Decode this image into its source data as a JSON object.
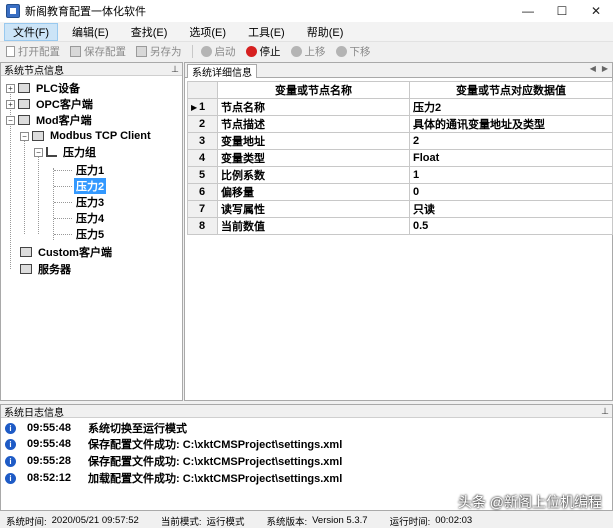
{
  "window": {
    "title": "新阁教育配置一体化软件",
    "minimize": "—",
    "maximize": "☐",
    "close": "✕"
  },
  "menu": [
    {
      "label": "文件(F)",
      "active": true
    },
    {
      "label": "编辑(E)"
    },
    {
      "label": "查找(E)"
    },
    {
      "label": "选项(E)"
    },
    {
      "label": "工具(E)"
    },
    {
      "label": "帮助(E)"
    }
  ],
  "toolbar": {
    "open": "打开配置",
    "save": "保存配置",
    "save_as": "另存为",
    "start": "启动",
    "stop": "停止",
    "up": "上移",
    "down": "下移"
  },
  "tree_panel": {
    "title": "系统节点信息",
    "pin": "⊥",
    "nodes": {
      "plc": "PLC设备",
      "opc": "OPC客户端",
      "mod": "Mod客户端",
      "modbus_tcp": "Modbus TCP Client",
      "group": "压力组",
      "p1": "压力1",
      "p2": "压力2",
      "p3": "压力3",
      "p4": "压力4",
      "p5": "压力5",
      "custom": "Custom客户端",
      "server": "服务器"
    }
  },
  "detail_panel": {
    "tab": "系统详细信息",
    "tab_prev": "◀",
    "tab_next": "▶",
    "columns": [
      "变量或节点名称",
      "变量或节点对应数据值"
    ],
    "current_row_marker": "▶",
    "rows": [
      {
        "no": "1",
        "name": "节点名称",
        "value": "压力2"
      },
      {
        "no": "2",
        "name": "节点描述",
        "value": "具体的通讯变量地址及类型"
      },
      {
        "no": "3",
        "name": "变量地址",
        "value": "2"
      },
      {
        "no": "4",
        "name": "变量类型",
        "value": "Float"
      },
      {
        "no": "5",
        "name": "比例系数",
        "value": "1"
      },
      {
        "no": "6",
        "name": "偏移量",
        "value": "0"
      },
      {
        "no": "7",
        "name": "读写属性",
        "value": "只读"
      },
      {
        "no": "8",
        "name": "当前数值",
        "value": "0.5"
      }
    ]
  },
  "log_panel": {
    "title": "系统日志信息",
    "pin": "⊥",
    "info_glyph": "i",
    "entries": [
      {
        "time": "09:55:48",
        "message": "系统切换至运行模式"
      },
      {
        "time": "09:55:48",
        "message": "保存配置文件成功: C:\\xktCMSProject\\settings.xml"
      },
      {
        "time": "09:55:28",
        "message": "保存配置文件成功: C:\\xktCMSProject\\settings.xml"
      },
      {
        "time": "08:52:12",
        "message": "加载配置文件成功: C:\\xktCMSProject\\settings.xml"
      }
    ],
    "watermark": "头条 @新阁上位机编程"
  },
  "statusbar": {
    "time_label": "系统时间:",
    "time_value": "2020/05/21 09:57:52",
    "mode_label": "当前模式:",
    "mode_value": "运行模式",
    "version_label": "系统版本:",
    "version_value": "Version  5.3.7",
    "runtime_label": "运行时间:",
    "runtime_value": "00:02:03"
  }
}
